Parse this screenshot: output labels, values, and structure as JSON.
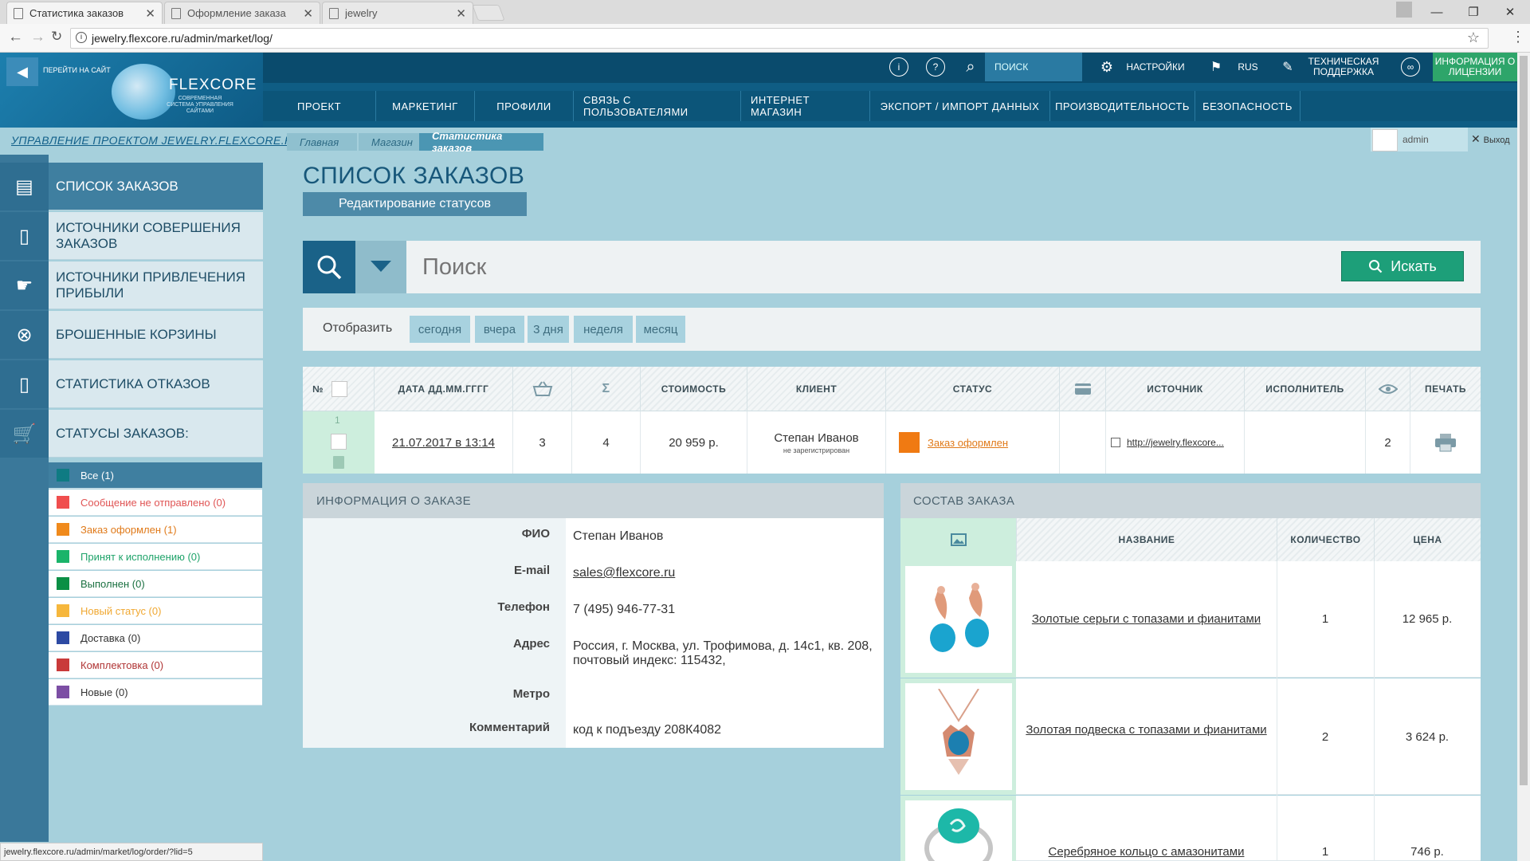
{
  "browser": {
    "tabs": [
      {
        "label": "Статистика заказов",
        "active": true
      },
      {
        "label": "Оформление заказа",
        "active": false
      },
      {
        "label": "jewelry",
        "active": false
      }
    ],
    "url": "jewelry.flexcore.ru/admin/market/log/",
    "status_url": "jewelry.flexcore.ru/admin/market/log/order/?lid=5"
  },
  "header": {
    "goto_site": "ПЕРЕЙТИ НА САЙТ",
    "logo": "FLEXCORE",
    "logo_sub": "СОВРЕМЕННАЯ СИСТЕМА УПРАВЛЕНИЯ САЙТАМИ",
    "search_placeholder": "ПОИСК",
    "settings": "НАСТРОЙКИ",
    "lang": "RUS",
    "support": "ТЕХНИЧЕСКАЯ ПОДДЕРЖКА",
    "license": "ИНФОРМАЦИЯ О ЛИЦЕНЗИИ",
    "menu": [
      "ПРОЕКТ",
      "МАРКЕТИНГ",
      "ПРОФИЛИ",
      "СВЯЗЬ С ПОЛЬЗОВАТЕЛЯМИ",
      "ИНТЕРНЕТ МАГАЗИН",
      "ЭКСПОРТ / ИМПОРТ ДАННЫХ",
      "ПРОИЗВОДИТЕЛЬНОСТЬ",
      "БЕЗОПАСНОСТЬ"
    ]
  },
  "breadcrumb": {
    "project": "УПРАВЛЕНИЕ ПРОЕКТОМ JEWELRY.FLEXCORE.RU",
    "items": [
      "Главная",
      "Магазин",
      "Статистика заказов"
    ]
  },
  "user": {
    "name": "admin",
    "logout": "Выход"
  },
  "sidebar": {
    "items": [
      {
        "label": "СПИСОК ЗАКАЗОВ",
        "icon": "order-list-icon",
        "active": true
      },
      {
        "label": "ИСТОЧНИКИ СОВЕРШЕНИЯ ЗАКАЗОВ",
        "icon": "devices-icon"
      },
      {
        "label": "ИСТОЧНИКИ ПРИВЛЕЧЕНИЯ ПРИБЫЛИ",
        "icon": "profit-hand-icon"
      },
      {
        "label": "БРОШЕННЫЕ КОРЗИНЫ",
        "icon": "abandoned-cart-icon"
      },
      {
        "label": "СТАТИСТИКА ОТКАЗОВ",
        "icon": "refusal-stats-icon"
      },
      {
        "label": "СТАТУСЫ ЗАКАЗОВ:",
        "icon": "cart-check-icon"
      }
    ],
    "statuses": [
      {
        "label": "Все (1)",
        "color": "#0f7b83",
        "text_color": "#ffffff",
        "active": true
      },
      {
        "label": "Сообщение не отправлено (0)",
        "color": "#f04e4e",
        "text_color": "#e05555"
      },
      {
        "label": "Заказ оформлен (1)",
        "color": "#f08a1c",
        "text_color": "#e07a1a"
      },
      {
        "label": "Принят к исполнению (0)",
        "color": "#1bb46a",
        "text_color": "#1fa36a"
      },
      {
        "label": "Выполнен (0)",
        "color": "#0b8f45",
        "text_color": "#1a7040"
      },
      {
        "label": "Новый статус (0)",
        "color": "#f6b73c",
        "text_color": "#f0a832"
      },
      {
        "label": "Доставка (0)",
        "color": "#2d4aa3",
        "text_color": "#333333"
      },
      {
        "label": "Комплектовка (0)",
        "color": "#c93a3a",
        "text_color": "#b03535"
      },
      {
        "label": "Новые (0)",
        "color": "#7c4ea4",
        "text_color": "#333333"
      }
    ]
  },
  "main": {
    "title": "СПИСОК ЗАКАЗОВ",
    "edit_statuses": "Редактирование статусов",
    "search_placeholder": "Поиск",
    "search_button": "Искать",
    "filter_label": "Отобразить",
    "filters": [
      "сегодня",
      "вчера",
      "3 дня",
      "неделя",
      "месяц"
    ]
  },
  "table": {
    "headers": {
      "num": "№",
      "date": "ДАТА ДД.ММ.ГГГГ",
      "sum": "Σ",
      "cost": "СТОИМОСТЬ",
      "client": "КЛИЕНТ",
      "status": "СТАТУС",
      "source": "ИСТОЧНИК",
      "executor": "ИСПОЛНИТЕЛЬ",
      "print": "ПЕЧАТЬ"
    },
    "row": {
      "num": "1",
      "date": "21.07.2017 в 13:14",
      "items": "3",
      "qty": "4",
      "cost": "20 959 р.",
      "client": "Степан Иванов",
      "client_note": "не зарегистрирован",
      "status": "Заказ оформлен",
      "status_color": "#f07a12",
      "source": "http://jewelry.flexcore...",
      "views": "2"
    }
  },
  "order_info": {
    "title": "ИНФОРМАЦИЯ О ЗАКАЗЕ",
    "fields": [
      {
        "label": "ФИО",
        "value": "Степан Иванов"
      },
      {
        "label": "E-mail",
        "value": "sales@flexcore.ru"
      },
      {
        "label": "Телефон",
        "value": "7 (495) 946-77-31"
      },
      {
        "label": "Адрес",
        "value": "Россия, г. Москва, ул. Трофимова, д. 14с1, кв. 208, почтовый индекс: 115432,"
      },
      {
        "label": "Метро",
        "value": ""
      },
      {
        "label": "Комментарий",
        "value": "код к подъезду 208К4082"
      }
    ]
  },
  "order_contents": {
    "title": "СОСТАВ ЗАКАЗА",
    "headers": {
      "name": "НАЗВАНИЕ",
      "qty": "КОЛИЧЕСТВО",
      "price": "ЦЕНА"
    },
    "items": [
      {
        "name": "Золотые серьги с топазами и фианитами",
        "qty": "1",
        "price": "12 965 р."
      },
      {
        "name": "Золотая подвеска с топазами и фианитами",
        "qty": "2",
        "price": "3 624 р."
      },
      {
        "name": "Серебряное кольцо с амазонитами",
        "qty": "1",
        "price": "746 р."
      }
    ]
  }
}
